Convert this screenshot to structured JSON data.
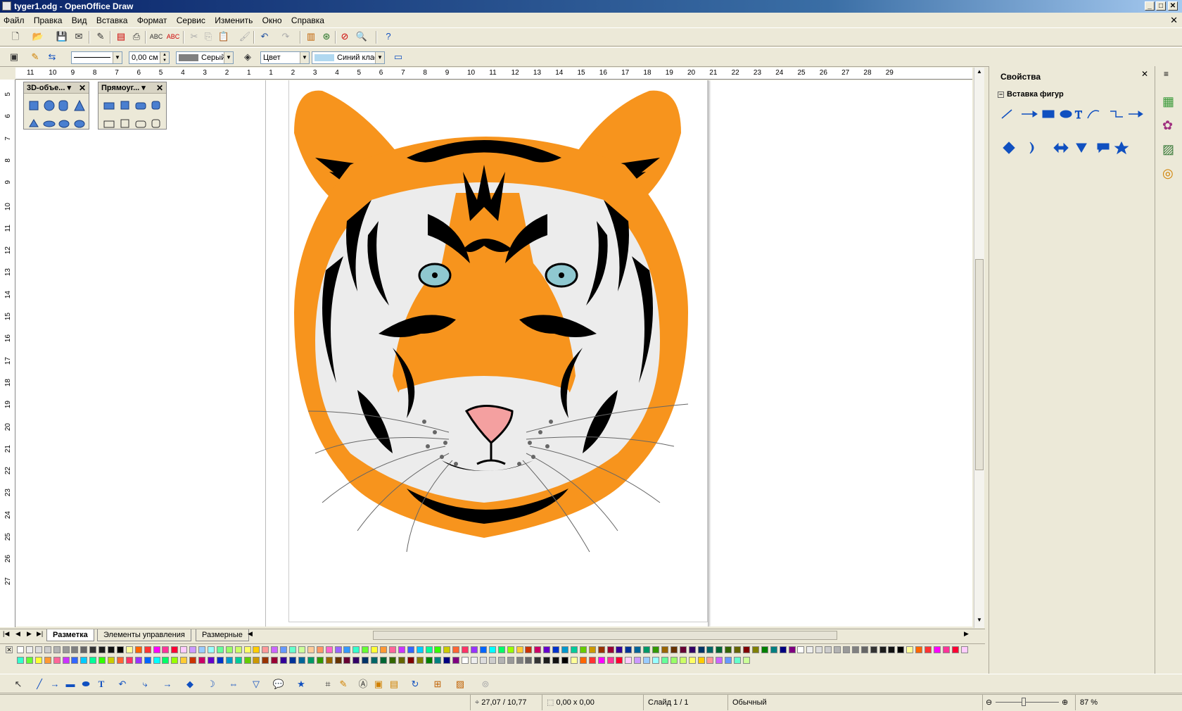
{
  "window": {
    "title": "tyger1.odg - OpenOffice Draw"
  },
  "menu": [
    "Файл",
    "Правка",
    "Вид",
    "Вставка",
    "Формат",
    "Сервис",
    "Изменить",
    "Окно",
    "Справка"
  ],
  "line_toolbar": {
    "line_width": "0,00 см",
    "area_style": "Серый",
    "fill_type": "Цвет",
    "fill_color": "Синий клас"
  },
  "ruler": {
    "h_numbers": [
      "11",
      "10",
      "9",
      "8",
      "7",
      "6",
      "5",
      "4",
      "3",
      "2",
      "1",
      "1",
      "2",
      "3",
      "4",
      "5",
      "6",
      "7",
      "8",
      "9",
      "10",
      "11",
      "12",
      "13",
      "14",
      "15",
      "16",
      "17",
      "18",
      "19",
      "20",
      "21",
      "22",
      "23",
      "24",
      "25",
      "26",
      "27",
      "28",
      "29"
    ],
    "v_numbers": [
      "5",
      "6",
      "7",
      "8",
      "9",
      "10",
      "11",
      "12",
      "13",
      "14",
      "15",
      "16",
      "17",
      "18",
      "19",
      "20",
      "21",
      "22",
      "23",
      "24",
      "25",
      "26",
      "27"
    ]
  },
  "float_3d": {
    "title": "3D-объе..."
  },
  "float_rect": {
    "title": "Прямоуг..."
  },
  "tabs": [
    "Разметка",
    "Элементы управления",
    "Размерные"
  ],
  "sidebar": {
    "title": "Свойства",
    "section": "Вставка фигур"
  },
  "status": {
    "position": "27,07 / 10,77",
    "size": "0,00 x 0,00",
    "slide": "Слайд 1 / 1",
    "layout": "Обычный",
    "zoom": "87 %"
  },
  "colors": {
    "tiger_orange": "#f7941d",
    "tiger_black": "#000000",
    "tiger_white": "#ececec",
    "eye": "#8fc8d0",
    "nose": "#f4a0a0"
  },
  "palette": [
    "#ffffff",
    "#eeeeee",
    "#dddddd",
    "#cccccc",
    "#b3b3b3",
    "#999999",
    "#808080",
    "#666666",
    "#333333",
    "#1c1c1c",
    "#111111",
    "#000000",
    "#ffff99",
    "#ff6600",
    "#ff3333",
    "#ff00ff",
    "#ff3399",
    "#ff0033",
    "#ffccff",
    "#cc99ff",
    "#99ccff",
    "#99ffff",
    "#66ff99",
    "#99ff66",
    "#ccff66",
    "#ffff66",
    "#ffcc00",
    "#ff9999",
    "#cc66ff",
    "#6699ff",
    "#66ffcc",
    "#ccff99",
    "#ffcc99",
    "#ff9966",
    "#ff66cc",
    "#9966ff",
    "#3399ff",
    "#33ffcc",
    "#66ff33",
    "#ffff33",
    "#ff9933",
    "#ff6699",
    "#cc33ff",
    "#3366ff",
    "#00ccff",
    "#00ff99",
    "#33ff00",
    "#cccc00",
    "#ff6633",
    "#ff3366",
    "#9933ff",
    "#0066ff",
    "#00ffff",
    "#00ff66",
    "#99ff00",
    "#ffcc33",
    "#cc3300",
    "#cc0066",
    "#6600cc",
    "#0033cc",
    "#0099cc",
    "#00cc99",
    "#66cc00",
    "#cc9900",
    "#993300",
    "#990033",
    "#330099",
    "#003399",
    "#006699",
    "#009966",
    "#339900",
    "#996600",
    "#663300",
    "#660033",
    "#330066",
    "#003366",
    "#006666",
    "#006633",
    "#336600",
    "#666600",
    "#800000",
    "#808000",
    "#008000",
    "#008080",
    "#000080",
    "#800080"
  ]
}
